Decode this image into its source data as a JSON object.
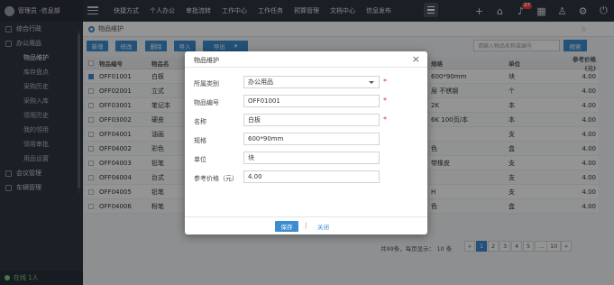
{
  "header": {
    "user_name": "管理员 -信息部",
    "nav": [
      "快捷方式",
      "个人办公",
      "审批流转",
      "工作中心",
      "工作任务",
      "预算管理",
      "文档中心",
      "信息发布"
    ],
    "notification_count": "27"
  },
  "sidebar": {
    "top_item": "综合行政",
    "group": "办公用品",
    "sub_items": [
      "物品维护",
      "库存盘点",
      "采购历史",
      "采购入库",
      "领用历史",
      "我的领用",
      "领用审批",
      "用品设置"
    ],
    "active_sub": "物品维护",
    "bottom_groups": [
      "会议管理",
      "车辆管理"
    ],
    "status": "在线 1人"
  },
  "breadcrumb": "物品维护",
  "toolbar": {
    "buttons": [
      "新增",
      "修改",
      "删除",
      "导入",
      "导出"
    ],
    "search_placeholder": "请输入物品名称或编号",
    "search_label": "搜索"
  },
  "table": {
    "headers": {
      "code": "物品编号",
      "name": "物品名",
      "spec": "规格",
      "unit": "单位",
      "price": "参考价格(元)"
    },
    "rows": [
      {
        "code": "OFF01001",
        "name": "白板",
        "spec": "600*90mm",
        "unit": "块",
        "price": "4.00",
        "checked": true
      },
      {
        "code": "OFF02001",
        "name": "立式",
        "spec": "层 不锈钢",
        "unit": "个",
        "price": "4.00"
      },
      {
        "code": "OFF03001",
        "name": "笔记本",
        "spec": "2K",
        "unit": "本",
        "price": "4.00"
      },
      {
        "code": "OFF03002",
        "name": "硬皮",
        "spec": "6K 100页/本",
        "unit": "本",
        "price": "4.00"
      },
      {
        "code": "OFF04001",
        "name": "油画",
        "spec": "",
        "unit": "支",
        "price": "4.00"
      },
      {
        "code": "OFF04002",
        "name": "彩色",
        "spec": "色",
        "unit": "盒",
        "price": "4.00"
      },
      {
        "code": "OFF04003",
        "name": "铅笔",
        "spec": "带橡皮",
        "unit": "支",
        "price": "4.00"
      },
      {
        "code": "OFF04004",
        "name": "台式",
        "spec": "",
        "unit": "支",
        "price": "4.00"
      },
      {
        "code": "OFF04005",
        "name": "铅笔",
        "spec": "H",
        "unit": "支",
        "price": "4.00"
      },
      {
        "code": "OFF04006",
        "name": "粉笔",
        "spec": "色",
        "unit": "盒",
        "price": "4.00"
      }
    ]
  },
  "pager": {
    "summary": "共99条，每页显示：",
    "page_size": "10",
    "per_unit": "条",
    "pages": [
      "«",
      "1",
      "2",
      "3",
      "4",
      "5",
      "…",
      "10",
      "»"
    ],
    "active_page": "1"
  },
  "modal": {
    "title": "物品维护",
    "fields": [
      {
        "label": "所属类别",
        "value": "办公用品",
        "type": "select",
        "required": true
      },
      {
        "label": "物品编号",
        "value": "OFF01001",
        "type": "text",
        "required": true
      },
      {
        "label": "名称",
        "value": "白板",
        "type": "text",
        "required": true
      },
      {
        "label": "规格",
        "value": "600*90mm",
        "type": "text",
        "required": false
      },
      {
        "label": "单位",
        "value": "块",
        "type": "text",
        "required": false
      },
      {
        "label": "参考价格（元）",
        "value": "4.00",
        "type": "text",
        "required": false
      }
    ],
    "save_label": "保存",
    "separator": "|",
    "close_label": "关闭"
  }
}
